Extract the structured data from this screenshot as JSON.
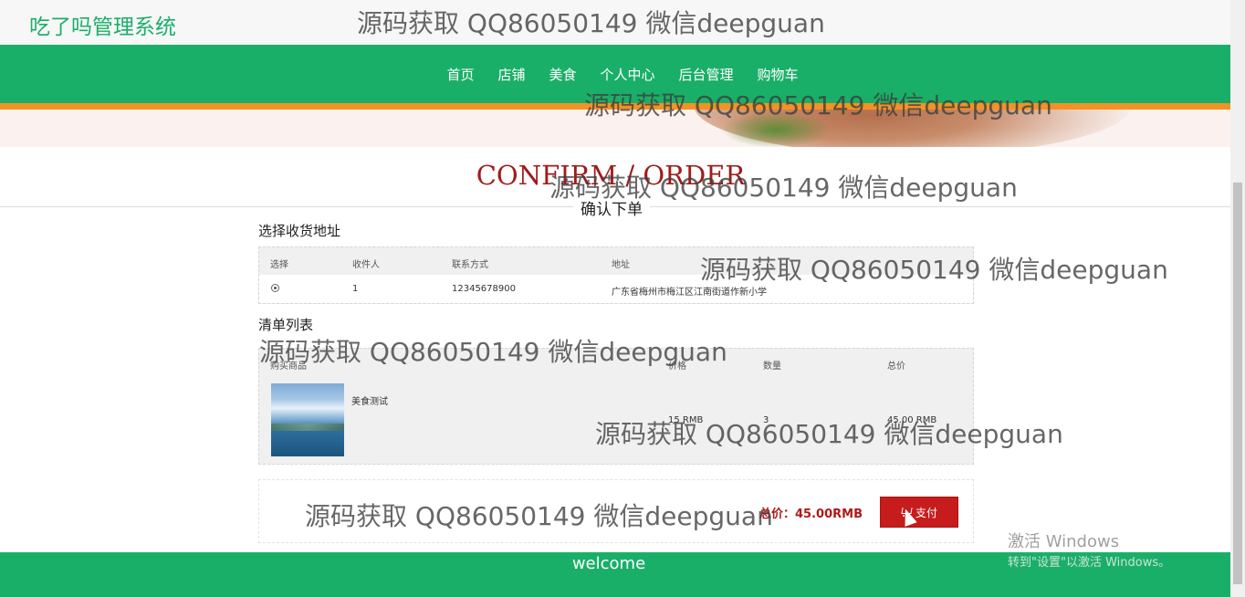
{
  "header": {
    "brand": "吃了吗管理系统"
  },
  "nav": {
    "items": [
      "首页",
      "店铺",
      "美食",
      "个人中心",
      "后台管理",
      "购物车"
    ]
  },
  "page": {
    "title_en": "CONFIRM / ORDER",
    "title_cn": "确认下单"
  },
  "address": {
    "section_title": "选择收货地址",
    "columns": [
      "选择",
      "收件人",
      "联系方式",
      "地址"
    ],
    "rows": [
      {
        "recipient": "1",
        "phone": "12345678900",
        "address": "广东省梅州市梅江区江南街道作新小学"
      }
    ]
  },
  "items": {
    "section_title": "清单列表",
    "columns": [
      "购买商品",
      "价格",
      "数量",
      "总价"
    ],
    "rows": [
      {
        "name": "美食测试",
        "price": "15 RMB",
        "qty": "3",
        "total": "45.00 RMB"
      }
    ]
  },
  "payment": {
    "total_label": "总价：45.00RMB",
    "pay_label": "支付"
  },
  "footer": {
    "text": "welcome"
  },
  "watermarks": [
    "源码获取 QQ86050149 微信deepguan",
    "源码获取 QQ86050149 微信deepguan",
    "源码获取 QQ86050149 微信deepguan",
    "源码获取 QQ86050149 微信deepguan",
    "源码获取 QQ86050149 微信deepguan",
    "源码获取 QQ86050149 微信deepguan",
    "源码获取 QQ86050149 微信deepguan"
  ],
  "os_notice": {
    "line1": "激活 Windows",
    "line2": "转到\"设置\"以激活 Windows。"
  },
  "colors": {
    "primary_green": "#1aaf68",
    "accent_orange": "#f49223",
    "pay_red": "#c71c1c"
  }
}
